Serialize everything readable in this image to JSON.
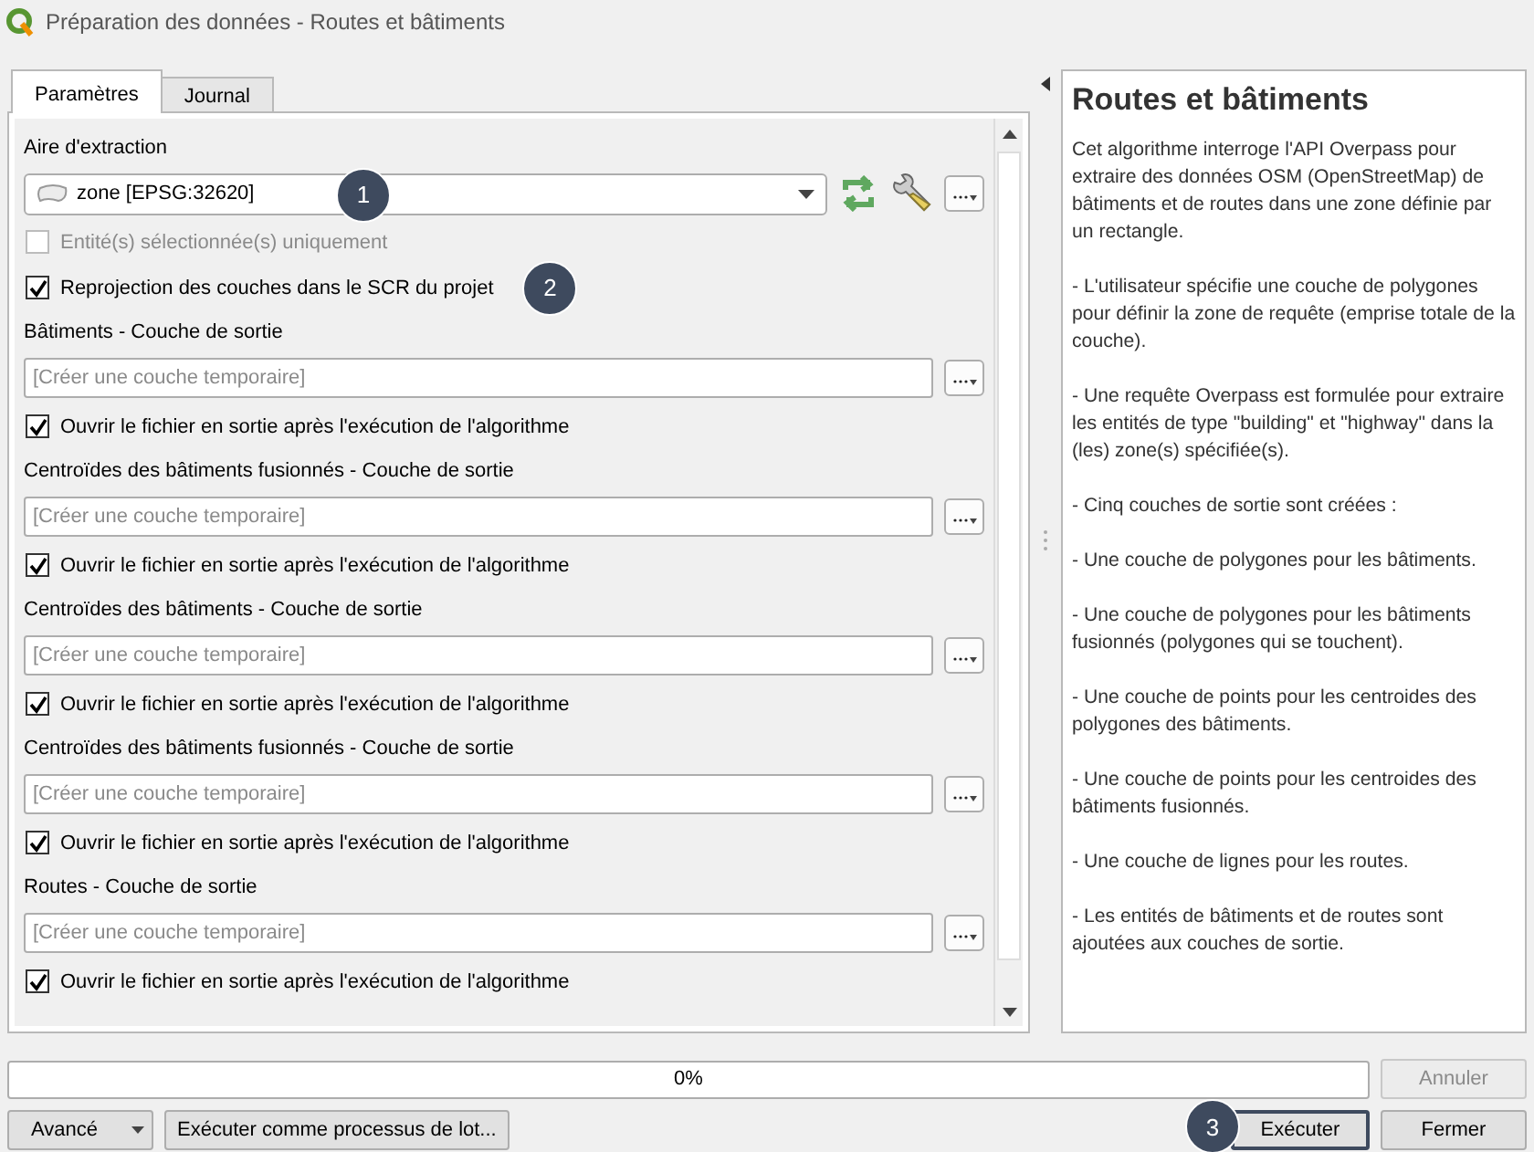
{
  "window": {
    "title": "Préparation des données - Routes et bâtiments"
  },
  "tabs": [
    {
      "label": "Paramètres",
      "selected": true
    },
    {
      "label": "Journal",
      "selected": false
    }
  ],
  "extraction": {
    "label": "Aire d'extraction",
    "value": "zone [EPSG:32620]",
    "callout": "1"
  },
  "selected_only": {
    "label": "Entité(s) sélectionnée(s) uniquement",
    "checked": false,
    "disabled": true
  },
  "reprojection": {
    "label": "Reprojection des couches dans le SCR du projet",
    "checked": true,
    "disabled": false,
    "callout": "2"
  },
  "outputs": [
    {
      "label": "Bâtiments - Couche de sortie",
      "placeholder": "[Créer une couche temporaire]",
      "open_label": "Ouvrir le fichier en sortie après l'exécution de l'algorithme",
      "open_checked": true
    },
    {
      "label": "Centroïdes des bâtiments fusionnés - Couche de sortie",
      "placeholder": "[Créer une couche temporaire]",
      "open_label": "Ouvrir le fichier en sortie après l'exécution de l'algorithme",
      "open_checked": true
    },
    {
      "label": "Centroïdes des bâtiments - Couche de sortie",
      "placeholder": "[Créer une couche temporaire]",
      "open_label": "Ouvrir le fichier en sortie après l'exécution de l'algorithme",
      "open_checked": true
    },
    {
      "label": "Centroïdes des bâtiments fusionnés - Couche de sortie",
      "placeholder": "[Créer une couche temporaire]",
      "open_label": "Ouvrir le fichier en sortie après l'exécution de l'algorithme",
      "open_checked": true
    },
    {
      "label": "Routes - Couche de sortie",
      "placeholder": "[Créer une couche temporaire]",
      "open_label": "Ouvrir le fichier en sortie après l'exécution de l'algorithme",
      "open_checked": true
    }
  ],
  "help": {
    "title": "Routes et bâtiments",
    "paragraphs": [
      "Cet algorithme interroge l'API Overpass pour extraire des données OSM (OpenStreetMap) de bâtiments et de routes dans une zone définie par un rectangle.",
      "- L'utilisateur spécifie une couche de polygones pour définir la zone de requête (emprise totale de la couche).",
      "- Une requête Overpass est formulée pour extraire les entités de type \"building\" et \"highway\" dans la (les) zone(s) spécifiée(s).",
      "- Cinq couches de sortie sont créées :",
      "- Une couche de polygones pour les bâtiments.",
      "- Une couche de polygones pour les bâtiments fusionnés (polygones qui se touchent).",
      "- Une couche de points pour les centroides des polygones des bâtiments.",
      "- Une couche de points pour les centroides des bâtiments fusionnés.",
      "- Une couche de lignes pour les routes.",
      "- Les entités de bâtiments et de routes sont ajoutées aux couches de sortie."
    ]
  },
  "progress": {
    "text": "0%",
    "level": 0
  },
  "buttons": {
    "cancel": {
      "label": "Annuler",
      "disabled": true
    },
    "advanced": {
      "label": "Avancé"
    },
    "batch": {
      "label": "Exécuter comme processus de lot..."
    },
    "run": {
      "label": "Exécuter",
      "callout": "3"
    },
    "close": {
      "label": "Fermer"
    }
  }
}
